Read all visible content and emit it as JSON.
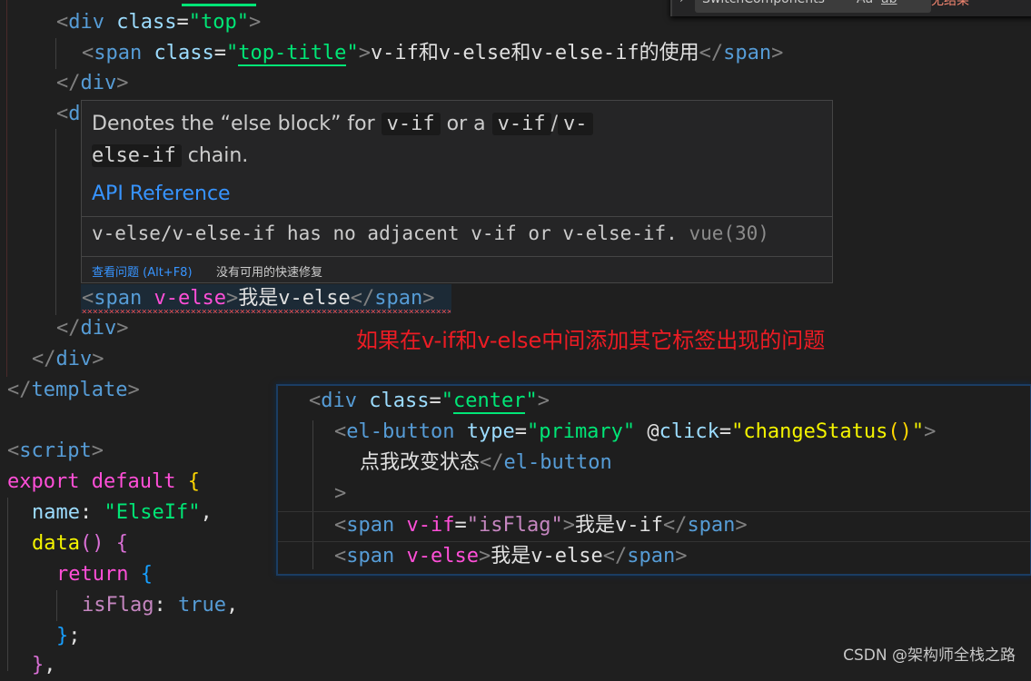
{
  "find_widget": {
    "query": "SwitchComponents",
    "options": [
      "Aa",
      "ab",
      "*"
    ],
    "result": "无结果"
  },
  "code": {
    "lines": [
      {
        "indent": "  ",
        "parts": [
          "<",
          "div",
          " ",
          "class",
          "=",
          "\"top\"",
          ">"
        ]
      },
      {
        "text_tag_open": "<span class=\"top-title\">",
        "content": "v-if和v-else和v-else-if的使用",
        "close": "</span>"
      },
      {
        "text": "</div>"
      },
      {
        "text": "<d"
      },
      {
        "text": "<span v-else>我是v-else</span>"
      },
      {
        "text": "</div>"
      },
      {
        "text": "</div>"
      },
      {
        "text": "</template>"
      },
      {
        "text": ""
      },
      {
        "text": "<script>"
      },
      {
        "text": "export default {"
      },
      {
        "text": "name: \"ElseIf\","
      },
      {
        "text": "data() {"
      },
      {
        "text": "return {"
      },
      {
        "text": "isFlag: true,"
      },
      {
        "text": "};"
      },
      {
        "text": "},"
      }
    ],
    "top_title_text": "v-if和v-else和v-else-if的使用",
    "class_top": "top",
    "class_top_title": "top-title",
    "v_else_content": "我是v-else",
    "name_value": "ElseIf",
    "is_flag_key": "isFlag",
    "is_flag_value": "true"
  },
  "hover": {
    "doc_prefix": "Denotes the “else block” for",
    "code1": "v-if",
    "doc_mid": "or a",
    "code2": "v-if",
    "slash": "/",
    "code3a": "v-",
    "code3b": "else-if",
    "doc_suffix": "chain.",
    "api_link": "API Reference",
    "diagnostic": "v-else/v-else-if has no adjacent v-if or v-else-if.",
    "diagnostic_code": "vue(30)",
    "view_problem": "查看问题 (Alt+F8)",
    "no_quick_fix": "没有可用的快速修复"
  },
  "annotation": "如果在v-if和v-else中间添加其它标签出现的问题",
  "snippet": {
    "class_center": "center",
    "button_type": "primary",
    "click_handler": "changeStatus",
    "button_text": "点我改变状态",
    "v_if_value": "isFlag",
    "v_if_content": "我是v-if",
    "v_else_content": "我是v-else"
  },
  "watermark": "CSDN @架构师全栈之路"
}
